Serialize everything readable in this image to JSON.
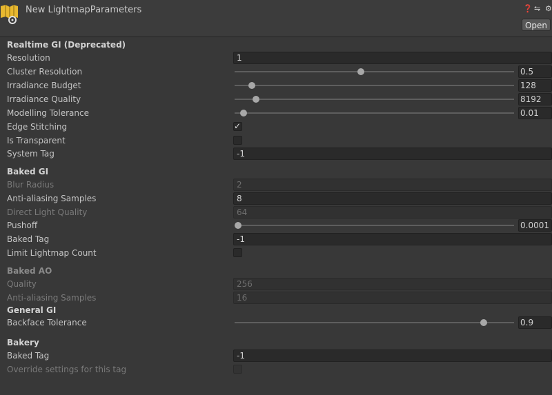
{
  "window": {
    "title": "New LightmapParameters",
    "open_label": "Open"
  },
  "sections": {
    "realtime": "Realtime GI (Deprecated)",
    "baked": "Baked GI",
    "baked_ao": "Baked AO",
    "general": "General GI",
    "bakery": "Bakery"
  },
  "realtime": {
    "resolution": {
      "label": "Resolution",
      "value": "1"
    },
    "cluster_resolution": {
      "label": "Cluster Resolution",
      "value": "0.5",
      "level": 0.45
    },
    "irradiance_budget": {
      "label": "Irradiance Budget",
      "value": "128",
      "level": 0.05
    },
    "irradiance_quality": {
      "label": "Irradiance Quality",
      "value": "8192",
      "level": 0.065
    },
    "modelling_tolerance": {
      "label": "Modelling Tolerance",
      "value": "0.01",
      "level": 0.02
    },
    "edge_stitching": {
      "label": "Edge Stitching",
      "checked": true
    },
    "is_transparent": {
      "label": "Is Transparent",
      "checked": false
    },
    "system_tag": {
      "label": "System Tag",
      "value": "-1"
    }
  },
  "baked": {
    "blur_radius": {
      "label": "Blur Radius",
      "value": "2"
    },
    "antialiasing_samples": {
      "label": "Anti-aliasing Samples",
      "value": "8"
    },
    "direct_light_quality": {
      "label": "Direct Light Quality",
      "value": "64"
    },
    "pushoff": {
      "label": "Pushoff",
      "value": "0.0001",
      "level": 0.0
    },
    "baked_tag": {
      "label": "Baked Tag",
      "value": "-1"
    },
    "limit_lightmap_count": {
      "label": "Limit Lightmap Count",
      "checked": false
    }
  },
  "baked_ao": {
    "quality": {
      "label": "Quality",
      "value": "256"
    },
    "antialiasing_samples": {
      "label": "Anti-aliasing Samples",
      "value": "16"
    }
  },
  "general": {
    "backface_tolerance": {
      "label": "Backface Tolerance",
      "value": "0.9",
      "level": 0.9
    }
  },
  "bakery": {
    "baked_tag": {
      "label": "Baked Tag",
      "value": "-1"
    },
    "override_settings": {
      "label": "Override settings for this tag",
      "checked": false
    }
  },
  "icons": {
    "asset": "lightmap-parameters-icon",
    "help": "help-icon",
    "settings": "preset-sliders-icon",
    "gear": "gear-icon"
  }
}
